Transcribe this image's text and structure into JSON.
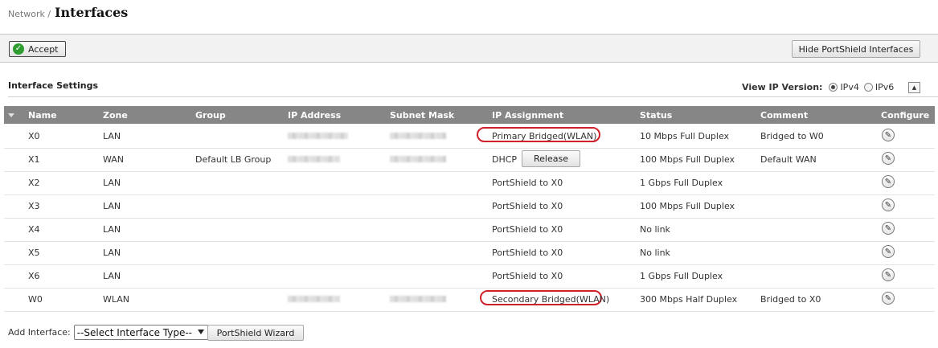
{
  "header": {
    "breadcrumb": "Network /",
    "title": "Interfaces"
  },
  "toolbar": {
    "accept_label": "Accept",
    "hide_label": "Hide PortShield Interfaces"
  },
  "section": {
    "title": "Interface Settings",
    "view_ip_label": "View IP Version:",
    "ipv4_label": "IPv4",
    "ipv6_label": "IPv6",
    "selected_version": "IPv4"
  },
  "table": {
    "columns": [
      "Name",
      "Zone",
      "Group",
      "IP Address",
      "Subnet Mask",
      "IP Assignment",
      "Status",
      "Comment",
      "Configure"
    ],
    "rows": [
      {
        "name": "X0",
        "zone": "LAN",
        "group": "",
        "ip_assignment": "Primary Bridged(WLAN)",
        "status": "10 Mbps Full Duplex",
        "comment": "Bridged to W0"
      },
      {
        "name": "X1",
        "zone": "WAN",
        "group": "Default LB Group",
        "ip_assignment": "DHCP",
        "status": "100 Mbps Full Duplex",
        "comment": "Default WAN",
        "action_label": "Release"
      },
      {
        "name": "X2",
        "zone": "LAN",
        "group": "",
        "ip_assignment": "PortShield to X0",
        "status": "1 Gbps Full Duplex",
        "comment": ""
      },
      {
        "name": "X3",
        "zone": "LAN",
        "group": "",
        "ip_assignment": "PortShield to X0",
        "status": "100 Mbps Full Duplex",
        "comment": ""
      },
      {
        "name": "X4",
        "zone": "LAN",
        "group": "",
        "ip_assignment": "PortShield to X0",
        "status": "No link",
        "comment": ""
      },
      {
        "name": "X5",
        "zone": "LAN",
        "group": "",
        "ip_assignment": "PortShield to X0",
        "status": "No link",
        "comment": ""
      },
      {
        "name": "X6",
        "zone": "LAN",
        "group": "",
        "ip_assignment": "PortShield to X0",
        "status": "1 Gbps Full Duplex",
        "comment": ""
      },
      {
        "name": "W0",
        "zone": "WLAN",
        "group": "",
        "ip_assignment": "Secondary Bridged(WLAN)",
        "status": "300 Mbps Half Duplex",
        "comment": "Bridged to X0"
      }
    ]
  },
  "footer": {
    "add_interface_label": "Add Interface:",
    "select_value": "--Select Interface Type--",
    "wizard_label": "PortShield Wizard"
  },
  "colors": {
    "header_bg": "#868686",
    "accept_check": "#2f9d2f",
    "highlight_oval": "#d0202a"
  },
  "icons": {
    "accept": "check-circle-icon",
    "configure": "pencil-edit-icon",
    "collapse": "triangle-up-icon",
    "sort": "triangle-down-icon"
  }
}
